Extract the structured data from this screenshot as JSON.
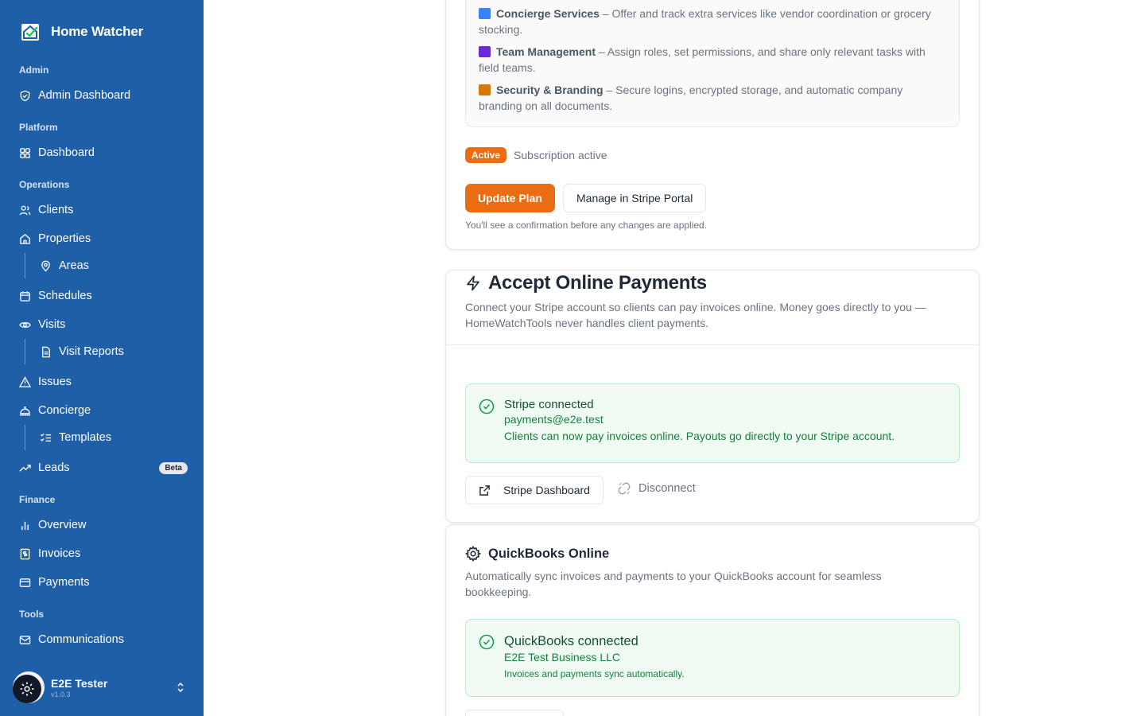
{
  "brand": {
    "name": "Home Watcher"
  },
  "sidebar": {
    "sections": {
      "admin": "Admin",
      "platform": "Platform",
      "operations": "Operations",
      "finance": "Finance",
      "tools": "Tools"
    },
    "items": {
      "admin_dashboard": "Admin Dashboard",
      "dashboard": "Dashboard",
      "clients": "Clients",
      "properties": "Properties",
      "areas": "Areas",
      "schedules": "Schedules",
      "visits": "Visits",
      "visit_reports": "Visit Reports",
      "issues": "Issues",
      "concierge": "Concierge",
      "templates": "Templates",
      "leads": "Leads",
      "leads_badge": "Beta",
      "overview": "Overview",
      "invoices": "Invoices",
      "payments": "Payments",
      "communications": "Communications"
    },
    "user": {
      "name": "E2E Tester",
      "version": "v1.0.3"
    }
  },
  "subscription": {
    "features": [
      {
        "title": "Concierge Services",
        "text": " – Offer and track extra services like vendor coordination or grocery stocking.",
        "emoji_color": "#3b82f6"
      },
      {
        "title": "Team Management",
        "text": " – Assign roles, set permissions, and share only relevant tasks with field teams.",
        "emoji_color": "#6d28d9"
      },
      {
        "title": "Security & Branding",
        "text": " – Secure logins, encrypted storage, and automatic company branding on all documents.",
        "emoji_color": "#d97706"
      }
    ],
    "status_badge": "Active",
    "status_text": "Subscription active",
    "update_button": "Update Plan",
    "manage_button": "Manage in Stripe Portal",
    "note": "You'll see a confirmation before any changes are applied."
  },
  "payments_card": {
    "title": "Accept Online Payments",
    "description": "Connect your Stripe account so clients can pay invoices online. Money goes directly to you — HomeWatchTools never handles client payments.",
    "status_title": "Stripe connected",
    "email": "payments@e2e.test",
    "status_detail": "Clients can now pay invoices online. Payouts go directly to your Stripe account.",
    "dashboard_button": "Stripe Dashboard",
    "disconnect_button": "Disconnect"
  },
  "quickbooks_card": {
    "title": "QuickBooks Online",
    "description": "Automatically sync invoices and payments to your QuickBooks account for seamless bookkeeping.",
    "status_title": "QuickBooks connected",
    "business": "E2E Test Business LLC",
    "detail": "Invoices and payments sync automatically."
  },
  "colors": {
    "sidebar": "#1f5fa8",
    "accent": "#ea6c13",
    "success": "#16803c"
  }
}
